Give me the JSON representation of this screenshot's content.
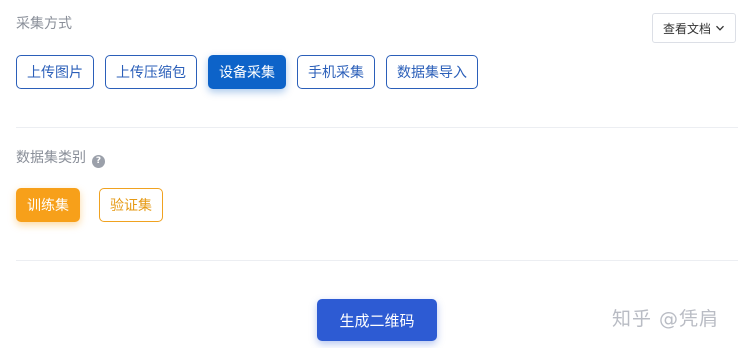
{
  "collection": {
    "label": "采集方式",
    "docs_button": "查看文档",
    "methods": [
      {
        "label": "上传图片",
        "active": false
      },
      {
        "label": "上传压缩包",
        "active": false
      },
      {
        "label": "设备采集",
        "active": true
      },
      {
        "label": "手机采集",
        "active": false
      },
      {
        "label": "数据集导入",
        "active": false
      }
    ]
  },
  "dataset_type": {
    "label": "数据集类别",
    "help_icon": "question-circle-icon",
    "types": [
      {
        "label": "训练集",
        "active": true
      },
      {
        "label": "验证集",
        "active": false
      }
    ]
  },
  "generate_button": "生成二维码",
  "watermark": "知乎 @凭肩",
  "colors": {
    "primary": "#0d63c9",
    "generate": "#2d5bd3",
    "orange": "#f7a01a"
  }
}
